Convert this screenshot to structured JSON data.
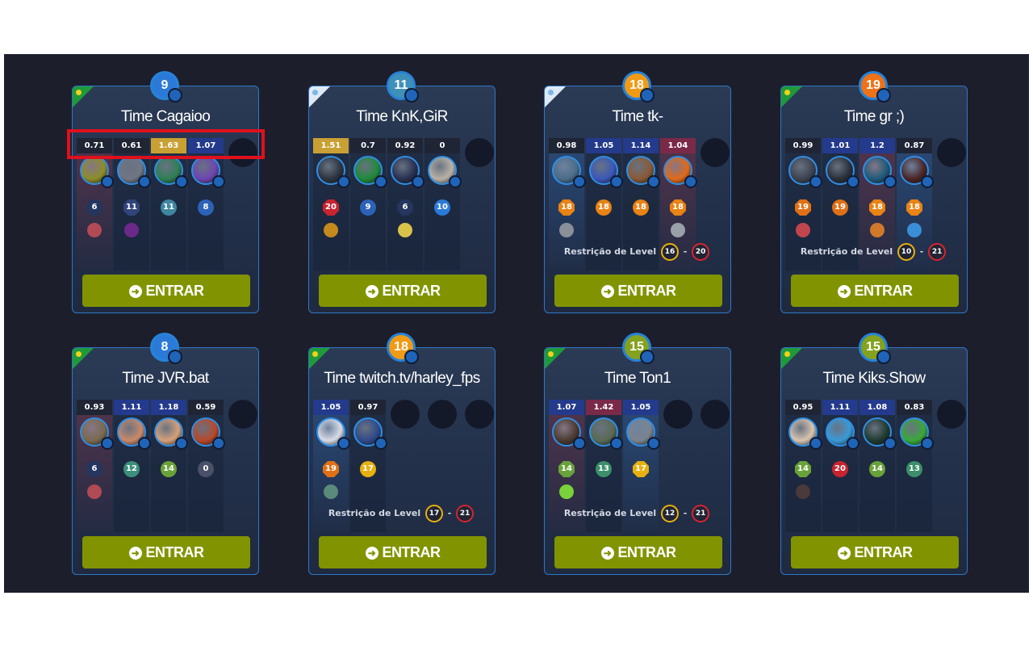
{
  "colors": {
    "panel": "#1d1e2c",
    "button": "#819400",
    "card_border": "#2d77c9",
    "highlight": "#e0101c"
  },
  "button_label": "ENTRAR",
  "button_icon": "arrow-circle-right-icon",
  "restriction_label": "Restrição de Level",
  "cards": [
    {
      "flag": "brazil",
      "title": "Time Cagaioo",
      "level": "9",
      "level_color": "#2c7ad8",
      "players": [
        {
          "score": "0.71",
          "score_bg": "#1f2535",
          "col": "warm",
          "avatar": "#8c8d2a",
          "rank": "6",
          "rank_color": "#24355e",
          "rank_shape": "hex",
          "medal": "#b04a55"
        },
        {
          "score": "0.61",
          "score_bg": "#1f2535",
          "col": "",
          "avatar": "#6f7685",
          "rank": "11",
          "rank_color": "#31447c",
          "rank_shape": "hex",
          "medal": "#6b2a8a"
        },
        {
          "score": "1.63",
          "score_bg": "#c9a033",
          "col": "",
          "avatar": "#2f7f55",
          "rank": "11",
          "rank_color": "#3f86a0",
          "rank_shape": "circle",
          "medal": ""
        },
        {
          "score": "1.07",
          "score_bg": "#243a8c",
          "col": "",
          "avatar": "#6d45b0",
          "rank": "8",
          "rank_color": "#2c63b8",
          "rank_shape": "circle",
          "medal": ""
        }
      ],
      "empty": 1,
      "restriction": null
    },
    {
      "flag": "argentina",
      "title": "Time KnK,GiR",
      "level": "11",
      "level_color": "#3f90b8",
      "players": [
        {
          "score": "1.51",
          "score_bg": "#c9a033",
          "col": "",
          "avatar": "#2c3440",
          "rank": "20",
          "rank_color": "#c8242f",
          "rank_shape": "hex",
          "medal": "#c48a1c"
        },
        {
          "score": "0.7",
          "score_bg": "#1f2535",
          "col": "",
          "avatar": "#1f8a3a",
          "rank": "9",
          "rank_color": "#2c63b8",
          "rank_shape": "circle",
          "medal": ""
        },
        {
          "score": "0.92",
          "score_bg": "#1f2535",
          "col": "",
          "avatar": "#273050",
          "rank": "6",
          "rank_color": "#24355e",
          "rank_shape": "hex",
          "medal": "#d8c24a"
        },
        {
          "score": "0",
          "score_bg": "#1f2535",
          "col": "",
          "avatar": "#b9b2a6",
          "rank": "10",
          "rank_color": "#2c7ad8",
          "rank_shape": "circle",
          "medal": ""
        }
      ],
      "empty": 1,
      "restriction": null
    },
    {
      "flag": "argentina",
      "title": "Time tk-",
      "level": "18",
      "level_color": "#f19a16",
      "players": [
        {
          "score": "0.98",
          "score_bg": "#1f2535",
          "col": "cool",
          "avatar": "#4a6d8a",
          "rank": "18",
          "rank_color": "#e88314",
          "rank_shape": "hex",
          "medal": "#8a8f99"
        },
        {
          "score": "1.05",
          "score_bg": "#243a8c",
          "col": "",
          "avatar": "#3a58b8",
          "rank": "18",
          "rank_color": "#e88314",
          "rank_shape": "circle",
          "medal": ""
        },
        {
          "score": "1.14",
          "score_bg": "#243a8c",
          "col": "",
          "avatar": "#8a5a35",
          "rank": "18",
          "rank_color": "#e88314",
          "rank_shape": "circle",
          "medal": ""
        },
        {
          "score": "1.04",
          "score_bg": "#7a2a48",
          "col": "warm",
          "avatar": "#e06a1a",
          "rank": "18",
          "rank_color": "#e88314",
          "rank_shape": "hex",
          "medal": "#9aa0a8"
        }
      ],
      "empty": 1,
      "restriction": {
        "min": "16",
        "max": "20"
      }
    },
    {
      "flag": "brazil",
      "title": "Time gr ;)",
      "level": "19",
      "level_color": "#ee7218",
      "players": [
        {
          "score": "0.99",
          "score_bg": "#1f2535",
          "col": "",
          "avatar": "#3c4250",
          "rank": "19",
          "rank_color": "#e07016",
          "rank_shape": "hex",
          "medal": "#c0454d"
        },
        {
          "score": "1.01",
          "score_bg": "#243a8c",
          "col": "",
          "avatar": "#2a2f3a",
          "rank": "19",
          "rank_color": "#e07016",
          "rank_shape": "circle",
          "medal": ""
        },
        {
          "score": "1.2",
          "score_bg": "#243a8c",
          "col": "warm",
          "avatar": "#1f5a7a",
          "rank": "18",
          "rank_color": "#e88314",
          "rank_shape": "hex",
          "medal": "#d0792a"
        },
        {
          "score": "0.87",
          "score_bg": "#1f2535",
          "col": "cool",
          "avatar": "#4a2525",
          "rank": "18",
          "rank_color": "#e88314",
          "rank_shape": "hex",
          "medal": "#3a8ed8"
        }
      ],
      "empty": 1,
      "restriction": {
        "min": "10",
        "max": "21"
      }
    },
    {
      "flag": "brazil",
      "title": "Time JVR.bat",
      "level": "8",
      "level_color": "#2c7ad8",
      "players": [
        {
          "score": "0.93",
          "score_bg": "#1f2535",
          "col": "warm",
          "avatar": "#7a6a50",
          "rank": "6",
          "rank_color": "#24355e",
          "rank_shape": "hex",
          "medal": "#b04a55"
        },
        {
          "score": "1.11",
          "score_bg": "#243a8c",
          "col": "",
          "avatar": "#c98a6a",
          "rank": "12",
          "rank_color": "#3c8f7a",
          "rank_shape": "circle",
          "medal": ""
        },
        {
          "score": "1.18",
          "score_bg": "#243a8c",
          "col": "",
          "avatar": "#d6a07a",
          "rank": "14",
          "rank_color": "#6aa23a",
          "rank_shape": "circle",
          "medal": ""
        },
        {
          "score": "0.59",
          "score_bg": "#1f2535",
          "col": "",
          "avatar": "#b8482a",
          "rank": "0",
          "rank_color": "#4a5068",
          "rank_shape": "circle",
          "medal": ""
        }
      ],
      "empty": 1,
      "restriction": null
    },
    {
      "flag": "brazil",
      "title": "Time twitch.tv/harley_fps",
      "level": "18",
      "level_color": "#f19a16",
      "players": [
        {
          "score": "1.05",
          "score_bg": "#243a8c",
          "col": "cool",
          "avatar": "#d8dce8",
          "rank": "19",
          "rank_color": "#e07016",
          "rank_shape": "hex",
          "medal": "#5a8a7a"
        },
        {
          "score": "0.97",
          "score_bg": "#1f2535",
          "col": "",
          "avatar": "#2f4a8a",
          "rank": "17",
          "rank_color": "#e8b00e",
          "rank_shape": "circle",
          "medal": ""
        }
      ],
      "empty": 3,
      "restriction": {
        "min": "17",
        "max": "21"
      }
    },
    {
      "flag": "brazil",
      "title": "Time Ton1",
      "level": "15",
      "level_color": "#84a21e",
      "players": [
        {
          "score": "1.07",
          "score_bg": "#243a8c",
          "col": "warm",
          "avatar": "#4a3a30",
          "rank": "14",
          "rank_color": "#6aa23a",
          "rank_shape": "hex",
          "medal": "#7ad23a"
        },
        {
          "score": "1.42",
          "score_bg": "#7a2a48",
          "col": "",
          "avatar": "#5a6a55",
          "rank": "13",
          "rank_color": "#3c8f6a",
          "rank_shape": "circle",
          "medal": ""
        },
        {
          "score": "1.05",
          "score_bg": "#243a8c",
          "col": "cool",
          "avatar": "#7a8490",
          "rank": "17",
          "rank_color": "#e8b00e",
          "rank_shape": "hex",
          "medal": ""
        }
      ],
      "empty": 2,
      "restriction": {
        "min": "12",
        "max": "21"
      }
    },
    {
      "flag": "brazil",
      "title": "Time Kiks.Show",
      "level": "15",
      "level_color": "#84a21e",
      "players": [
        {
          "score": "0.95",
          "score_bg": "#1f2535",
          "col": "",
          "avatar": "#d8c4b0",
          "rank": "14",
          "rank_color": "#6aa23a",
          "rank_shape": "hex",
          "medal": "#4a3a3a"
        },
        {
          "score": "1.11",
          "score_bg": "#243a8c",
          "col": "",
          "avatar": "#3a9ad8",
          "rank": "20",
          "rank_color": "#c8242f",
          "rank_shape": "circle",
          "medal": ""
        },
        {
          "score": "1.08",
          "score_bg": "#243a8c",
          "col": "",
          "avatar": "#1f3a30",
          "rank": "14",
          "rank_color": "#6aa23a",
          "rank_shape": "circle",
          "medal": ""
        },
        {
          "score": "0.83",
          "score_bg": "#1f2535",
          "col": "",
          "avatar": "#3aa83a",
          "rank": "13",
          "rank_color": "#3c8f6a",
          "rank_shape": "circle",
          "medal": ""
        }
      ],
      "empty": 1,
      "restriction": null
    }
  ]
}
